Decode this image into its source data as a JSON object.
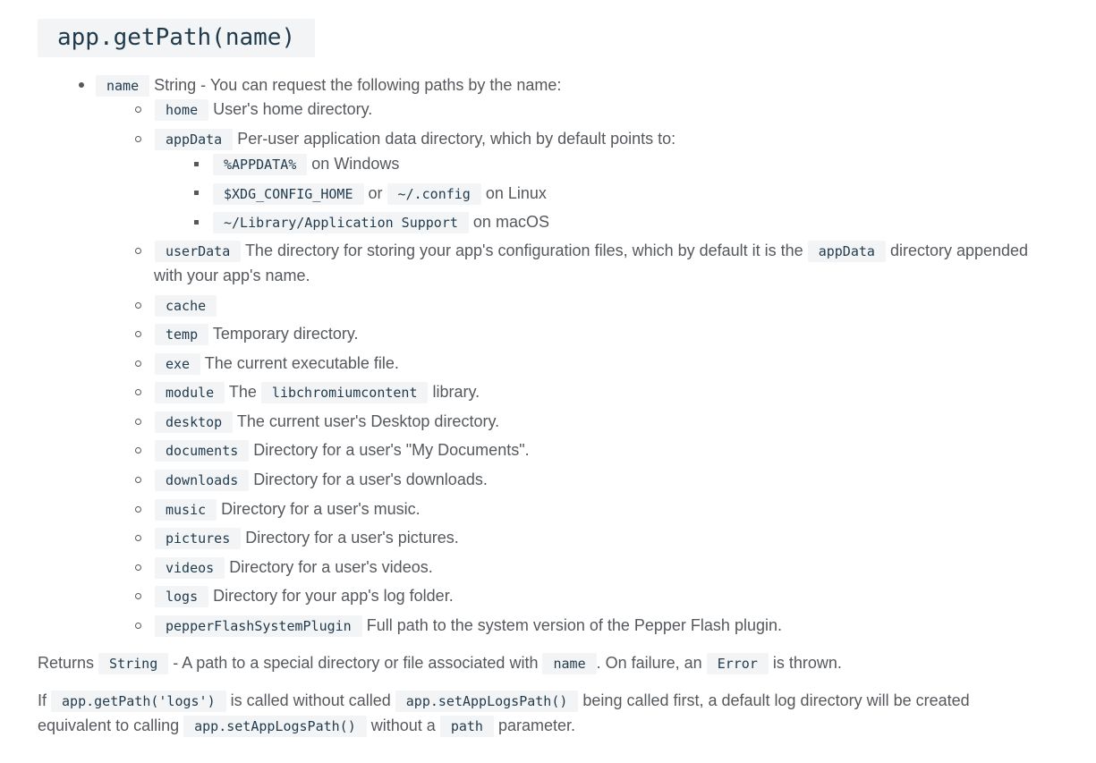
{
  "heading": "app.getPath(name)",
  "param": {
    "code": "name",
    "text": "String - You can request the following paths by the name:"
  },
  "paths": [
    {
      "code": "home",
      "text": "User's home directory."
    },
    {
      "code": "appData",
      "text": "Per-user application data directory, which by default points to:"
    },
    {
      "code": "userData",
      "text_a": "The directory for storing your app's configuration files, which by default it is the",
      "code2": "appData",
      "text_b": "directory appended",
      "text_c": "with your app's name."
    },
    {
      "code": "cache",
      "text": ""
    },
    {
      "code": "temp",
      "text": "Temporary directory."
    },
    {
      "code": "exe",
      "text": "The current executable file."
    },
    {
      "code": "module",
      "text_a": "The",
      "code2": "libchromiumcontent",
      "text_b": "library."
    },
    {
      "code": "desktop",
      "text": "The current user's Desktop directory."
    },
    {
      "code": "documents",
      "text": "Directory for a user's \"My Documents\"."
    },
    {
      "code": "downloads",
      "text": "Directory for a user's downloads."
    },
    {
      "code": "music",
      "text": "Directory for a user's music."
    },
    {
      "code": "pictures",
      "text": "Directory for a user's pictures."
    },
    {
      "code": "videos",
      "text": "Directory for a user's videos."
    },
    {
      "code": "logs",
      "text": "Directory for your app's log folder."
    },
    {
      "code": "pepperFlashSystemPlugin",
      "text": "Full path to the system version of the Pepper Flash plugin."
    }
  ],
  "appdata_sub": [
    {
      "code": "%APPDATA%",
      "text": "on Windows"
    },
    {
      "code": "$XDG_CONFIG_HOME",
      "or": "or",
      "code2": "~/.config",
      "text": "on Linux"
    },
    {
      "code": "~/Library/Application Support",
      "text": "on macOS"
    }
  ],
  "returns": {
    "a": "Returns",
    "code1": "String",
    "b": "- A path to a special directory or file associated with",
    "code2": "name",
    "c": ". On failure, an",
    "code3": "Error",
    "d": "is thrown."
  },
  "note": {
    "a": "If",
    "code1": "app.getPath('logs')",
    "b": "is called without called",
    "code2": "app.setAppLogsPath()",
    "c": "being called first, a default log directory will be created",
    "d": "equivalent to calling",
    "code3": "app.setAppLogsPath()",
    "e": "without a",
    "code4": "path",
    "f": "parameter."
  }
}
